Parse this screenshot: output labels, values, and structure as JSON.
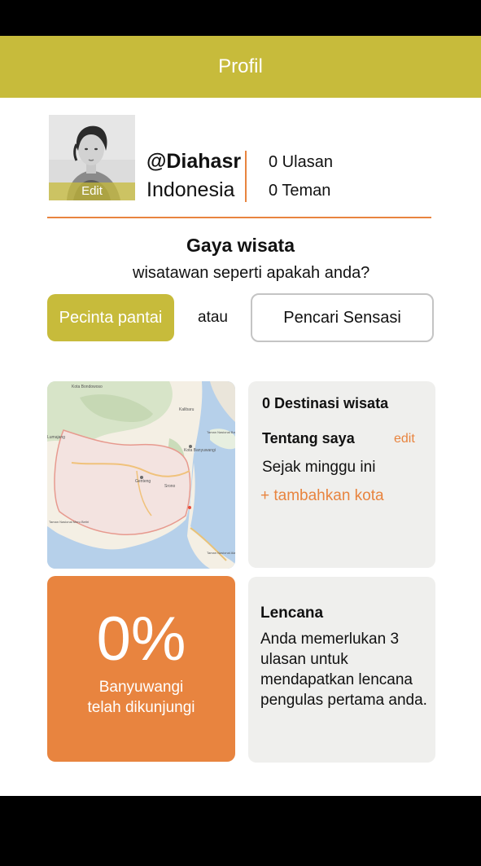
{
  "header": {
    "title": "Profil"
  },
  "profile": {
    "avatar_edit_label": "Edit",
    "username": "@Diahasr",
    "country": "Indonesia",
    "reviews": "0 Ulasan",
    "friends": "0 Teman"
  },
  "travel_style": {
    "title": "Gaya wisata",
    "question": "wisatawan seperti apakah anda?",
    "option_selected": "Pecinta pantai",
    "or_label": "atau",
    "option_other": "Pencari Sensasi"
  },
  "info": {
    "destinations": "0 Destinasi wisata",
    "about_title": "Tentang saya",
    "about_edit": "edit",
    "since": "Sejak minggu ini",
    "add_city": "+ tambahkan kota"
  },
  "progress": {
    "percent": "0%",
    "caption_line1": "Banyuwangi",
    "caption_line2": "telah dikunjungi"
  },
  "badge": {
    "title": "Lencana",
    "text": "Anda memerlukan 3 ulasan untuk mendapatkan lencana pengulas pertama anda."
  },
  "map": {
    "labels": [
      "Kota Bondowoso",
      "Lumajang",
      "Kalibaru",
      "Kota Banyuwangi",
      "Genteng",
      "Srono",
      "Taman Nasional Bali Barat",
      "Taman Nasional Meru Betiri",
      "Taman Nasional Alas Purwo"
    ]
  },
  "colors": {
    "brand": "#c7bb3b",
    "accent": "#e8843f",
    "card": "#efefed"
  }
}
